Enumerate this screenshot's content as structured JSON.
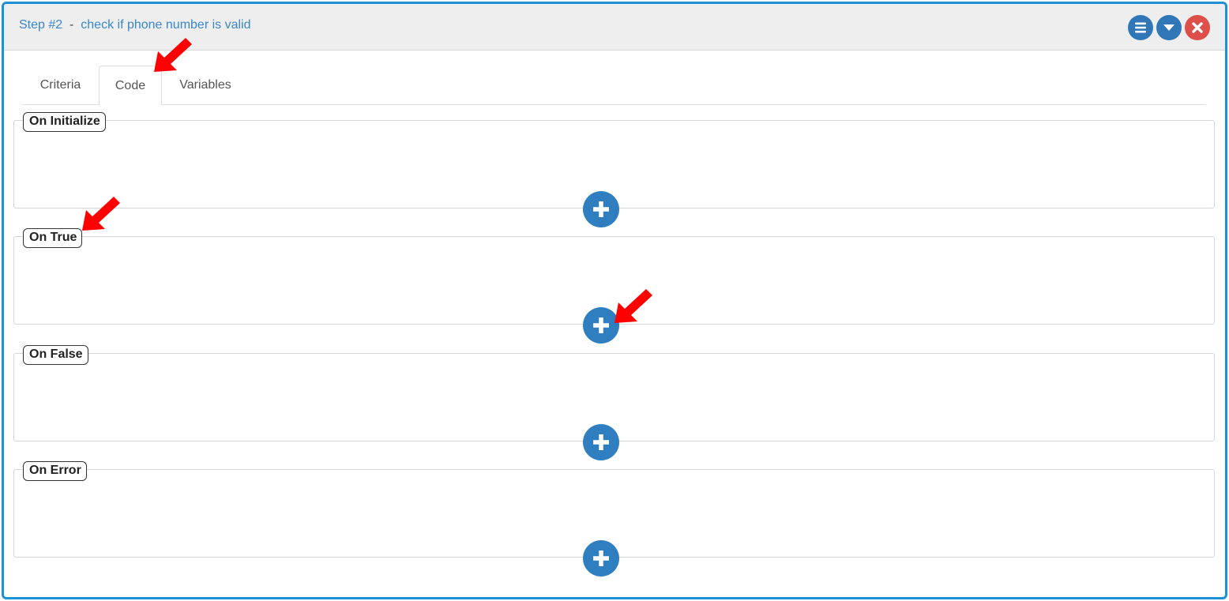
{
  "header": {
    "step_label": "Step #2",
    "separator": "-",
    "step_name": "check if phone number is valid",
    "buttons": [
      {
        "name": "menu-button",
        "icon": "hamburger-menu-icon"
      },
      {
        "name": "collapse-button",
        "icon": "caret-down-icon"
      },
      {
        "name": "close-button",
        "icon": "close-x-icon"
      }
    ]
  },
  "tabs": [
    {
      "label": "Criteria",
      "active": false
    },
    {
      "label": "Code",
      "active": true
    },
    {
      "label": "Variables",
      "active": false
    }
  ],
  "sections": [
    {
      "title": "On Initialize"
    },
    {
      "title": "On True"
    },
    {
      "title": "On False"
    },
    {
      "title": "On Error"
    }
  ],
  "annotations": {
    "arrow_color": "#ff0000",
    "arrow_icon": "red-annotation-arrow-icon"
  },
  "colors": {
    "frame_border": "#1e90d6",
    "accent_blue": "#2f7fc0",
    "close_red": "#dd4f48",
    "title_blue": "#3a87c8"
  }
}
